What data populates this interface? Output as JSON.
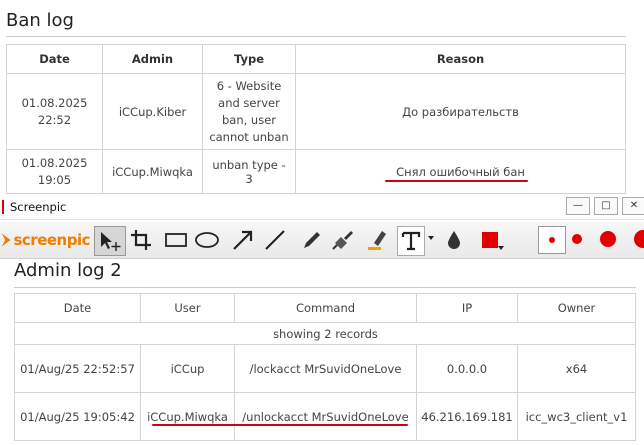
{
  "ban_log": {
    "title": "Ban log",
    "headers": [
      "Date",
      "Admin",
      "Type",
      "Reason"
    ],
    "rows": [
      {
        "date": "01.08.2025 22:52",
        "admin": "iCCup.Kiber",
        "type": "6 - Website and server ban, user cannot unban",
        "reason": "До разбирательств"
      },
      {
        "date": "01.08.2025 19:05",
        "admin": "iCCup.Miwqka",
        "type": "unban type - 3",
        "reason": "Снял ошибочный бан"
      }
    ],
    "highlight_color": "#d0021b"
  },
  "screenpic": {
    "window_title": "Screenpic",
    "logo_text": "screenpic",
    "win_buttons": [
      "—",
      "□",
      "✕"
    ],
    "tools": [
      "pointer-move",
      "crop",
      "rectangle",
      "ellipse",
      "arrow",
      "line",
      "pen",
      "brush",
      "marker",
      "text",
      "blur",
      "color",
      "size-small",
      "size-medium",
      "size-large",
      "size-xlarge"
    ],
    "accent_color": "#e10000",
    "logo_color": "#f07d00"
  },
  "admin_log": {
    "title": "Admin log 2",
    "headers": [
      "Date",
      "User",
      "Command",
      "IP",
      "Owner"
    ],
    "records_text": "showing 2 records",
    "rows": [
      {
        "date": "01/Aug/25 22:52:57",
        "user": "iCCup",
        "command": "/lockacct MrSuvidOneLove",
        "ip": "0.0.0.0",
        "owner": "x64"
      },
      {
        "date": "01/Aug/25 19:05:42",
        "user": "iCCup.Miwqka",
        "command": "/unlockacct MrSuvidOneLove",
        "ip": "46.216.169.181",
        "owner": "icc_wc3_client_v1"
      }
    ]
  }
}
